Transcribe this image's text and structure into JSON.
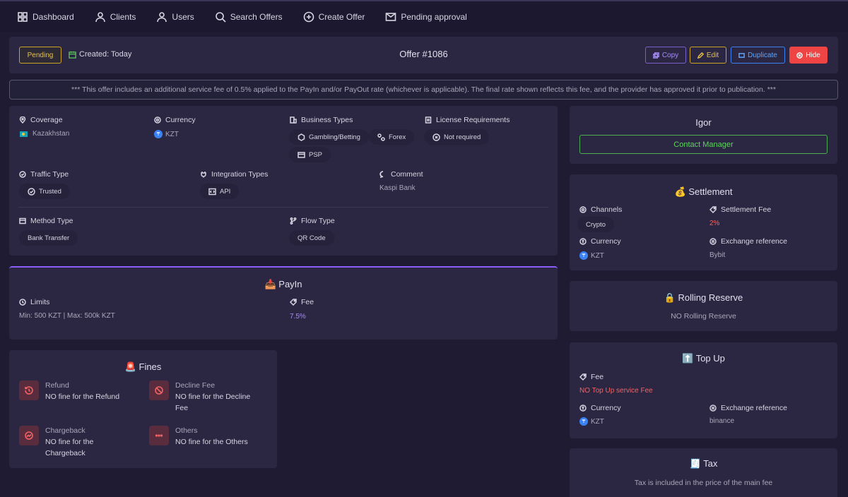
{
  "nav": {
    "dashboard": "Dashboard",
    "clients": "Clients",
    "users": "Users",
    "search_offers": "Search Offers",
    "create_offer": "Create Offer",
    "pending_approval": "Pending approval"
  },
  "header": {
    "status": "Pending",
    "created": "Created: Today",
    "title": "Offer #1086",
    "copy": "Copy",
    "edit": "Edit",
    "duplicate": "Duplicate",
    "hide": "Hide"
  },
  "notice": "*** This offer includes an additional service fee of 0.5% applied to the PayIn and/or PayOut rate (whichever is applicable). The final rate shown reflects this fee, and the provider has approved it prior to publication. ***",
  "details": {
    "coverage_label": "Coverage",
    "coverage_value": "Kazakhstan",
    "currency_label": "Currency",
    "currency_value": "KZT",
    "business_types_label": "Business Types",
    "business_types": [
      "Gambling/Betting",
      "Forex",
      "PSP"
    ],
    "license_label": "License Requirements",
    "license_value": "Not required",
    "traffic_label": "Traffic Type",
    "traffic_value": "Trusted",
    "integration_label": "Integration Types",
    "integration_value": "API",
    "comment_label": "Comment",
    "comment_value": "Kaspi Bank",
    "method_label": "Method Type",
    "method_value": "Bank Transfer",
    "flow_label": "Flow Type",
    "flow_value": "QR Code"
  },
  "payin": {
    "title": "PayIn",
    "limits_label": "Limits",
    "limits_value": "Min: 500 KZT | Max: 500k KZT",
    "fee_label": "Fee",
    "fee_value": "7.5%"
  },
  "fines": {
    "title": "Fines",
    "refund_label": "Refund",
    "refund_value": "NO fine for the Refund",
    "decline_label": "Decline Fee",
    "decline_value_1": "NO fine for the Decline",
    "decline_value_2": "Fee",
    "chargeback_label": "Chargeback",
    "chargeback_value_1": "NO fine for the",
    "chargeback_value_2": "Chargeback",
    "others_label": "Others",
    "others_value": "NO fine for the Others"
  },
  "manager": {
    "name": "Igor",
    "contact": "Contact Manager"
  },
  "settlement": {
    "title": "Settlement",
    "channels_label": "Channels",
    "channels_value": "Crypto",
    "fee_label": "Settlement Fee",
    "fee_value": "2%",
    "currency_label": "Currency",
    "currency_value": "KZT",
    "exchange_label": "Exchange reference",
    "exchange_value": "Bybit"
  },
  "rolling": {
    "title": "Rolling Reserve",
    "value": "NO Rolling Reserve"
  },
  "topup": {
    "title": "Top Up",
    "fee_label": "Fee",
    "fee_value": "NO Top Up service Fee",
    "currency_label": "Currency",
    "currency_value": "KZT",
    "exchange_label": "Exchange reference",
    "exchange_value": "binance"
  },
  "tax": {
    "title": "Tax",
    "value": "Tax is included in the price of the main fee"
  },
  "colors": {
    "background": "#1f1b33",
    "card": "#2b2742",
    "pending": "#c9a227",
    "accent_purple": "#8b5cf6",
    "danger": "#ef4444",
    "success": "#4caf50",
    "info": "#3b82f6"
  }
}
